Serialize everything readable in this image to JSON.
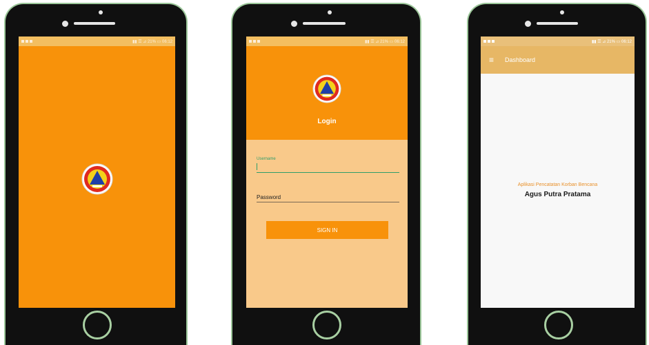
{
  "status_bar": {
    "text": "▮▮ ☰ ⊿ 21% ▭ 06:12"
  },
  "splash": {},
  "login": {
    "title": "Login",
    "username_label": "Username",
    "password_label": "Password",
    "sign_in_button": "SIGN IN"
  },
  "dashboard": {
    "menu_icon": "≡",
    "title": "Dashboard",
    "app_name": "Aplikasi Pencatatan Korban Bencana",
    "author": "Agus Putra Pratama"
  },
  "icons": [
    "hamburger-menu-icon",
    "emblem-logo",
    "battery-icon",
    "signal-icon"
  ],
  "colors": {
    "orange": "#f8920a",
    "light_orange": "#f9c98a",
    "toolbar": "#e7b765",
    "status_bar": "#f3c66f",
    "accent_green": "#2e9d6a",
    "app_name_color": "#e8902a"
  }
}
